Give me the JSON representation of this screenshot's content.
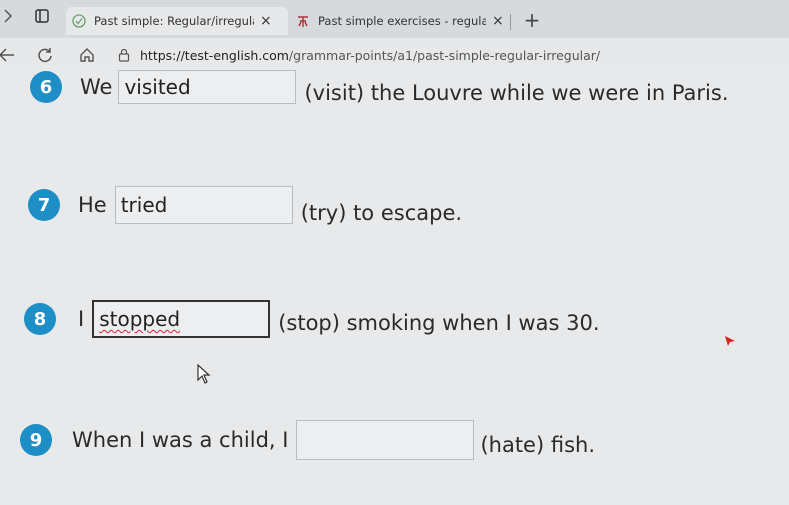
{
  "browser": {
    "tabs": [
      {
        "title": "Past simple: Regular/irregular ver",
        "favicon": "check-circle-icon",
        "active": true
      },
      {
        "title": "Past simple exercises - regular ver",
        "favicon": "site-logo-icon",
        "active": false
      }
    ],
    "close_glyph": "×",
    "newtab_glyph": "+",
    "url_host": "https://test-english.com",
    "url_path": "/grammar-points/a1/past-simple-regular-irregular/"
  },
  "exercise": {
    "items": [
      {
        "number": "6",
        "before": "We",
        "answer": "visited",
        "after": "(visit) the Louvre while we were in Paris."
      },
      {
        "number": "7",
        "before": "He",
        "answer": "tried",
        "after": "(try) to escape."
      },
      {
        "number": "8",
        "before": "I",
        "answer": "stopped",
        "after": "(stop) smoking when I was 30."
      },
      {
        "number": "9",
        "before": "When I was a child, I",
        "answer": "",
        "after": "(hate) fish."
      }
    ]
  },
  "colors": {
    "number_badge": "#1e8ec6",
    "background": "#e7e9eb"
  }
}
